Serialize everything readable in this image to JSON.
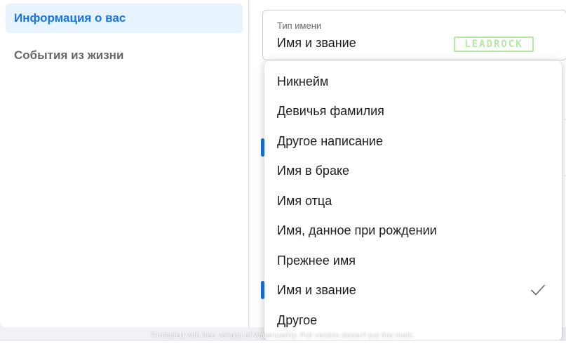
{
  "sidebar": {
    "items": [
      {
        "label": "Информация о вас",
        "active": true
      },
      {
        "label": "События из жизни",
        "active": false
      }
    ]
  },
  "name_type_field": {
    "label": "Тип имени",
    "value": "Имя и звание"
  },
  "brand_badge": "LEADROCK",
  "dropdown": {
    "options": [
      "Никнейм",
      "Девичья фамилия",
      "Другое написание",
      "Имя в браке",
      "Имя отца",
      "Имя, данное при рождении",
      "Прежнее имя",
      "Имя и звание",
      "Другое"
    ],
    "selected": "Имя и звание"
  },
  "watermark": "Protected with free version of Watermarkly. Full version doesn't put this mark.",
  "colors": {
    "accent": "#1b74e4",
    "active_bg": "#e7f3ff",
    "text": "#1c1e21",
    "muted": "#65676b"
  },
  "icons": {
    "selected_check": "check-icon"
  }
}
